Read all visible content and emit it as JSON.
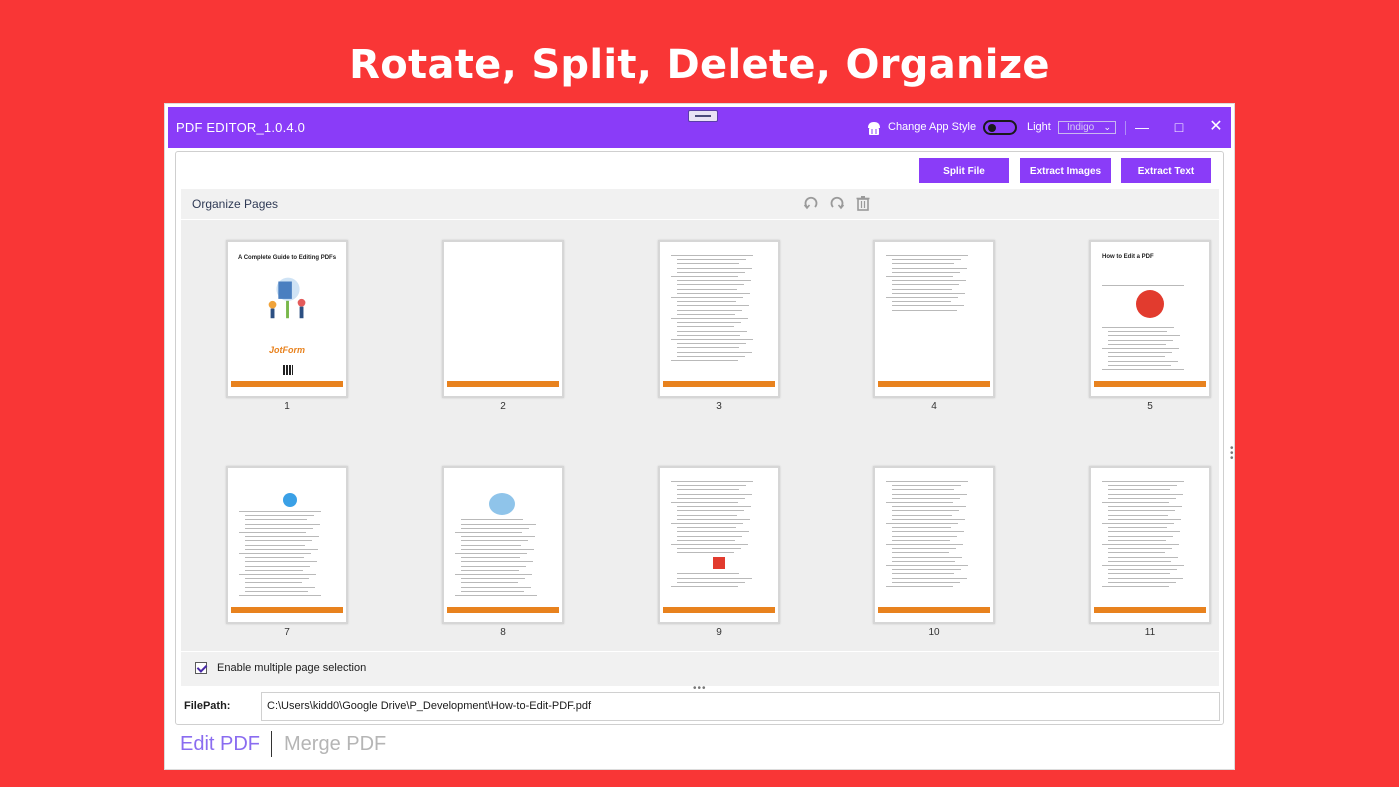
{
  "banner": {
    "title": "Rotate, Split, Delete, Organize"
  },
  "titlebar": {
    "app_title": "PDF EDITOR_1.0.4.0",
    "change_style_label": "Change App Style",
    "theme_mode_label": "Light",
    "theme_color": "Indigo",
    "icons": {
      "style": "cupcake-icon",
      "minimize": "minimize-icon",
      "maximize": "maximize-icon",
      "close": "close-icon"
    }
  },
  "toolbar": {
    "split_label": "Split File",
    "extract_images_label": "Extract Images",
    "extract_text_label": "Extract Text"
  },
  "organize": {
    "title": "Organize Pages",
    "tools": [
      "rotate-left-icon",
      "rotate-right-icon",
      "trash-icon"
    ],
    "pages": [
      {
        "number": "1",
        "thumb_title": "A Complete Guide to Editing PDFs",
        "thumb_logo": "JotForm"
      },
      {
        "number": "2"
      },
      {
        "number": "3"
      },
      {
        "number": "4"
      },
      {
        "number": "5",
        "thumb_title": "How to Edit a PDF"
      },
      {
        "number": "7"
      },
      {
        "number": "8"
      },
      {
        "number": "9"
      },
      {
        "number": "10"
      },
      {
        "number": "11"
      }
    ]
  },
  "selection": {
    "label": "Enable multiple page selection",
    "checked": true
  },
  "filepath": {
    "label": "FilePath:",
    "value": "C:\\Users\\kidd0\\Google Drive\\P_Development\\How-to-Edit-PDF.pdf"
  },
  "modes": {
    "edit": "Edit PDF",
    "merge": "Merge PDF",
    "active": "Edit PDF"
  },
  "colors": {
    "accent": "#8a3cf8",
    "background": "#f93636",
    "thumb_footer": "#e8821e"
  }
}
